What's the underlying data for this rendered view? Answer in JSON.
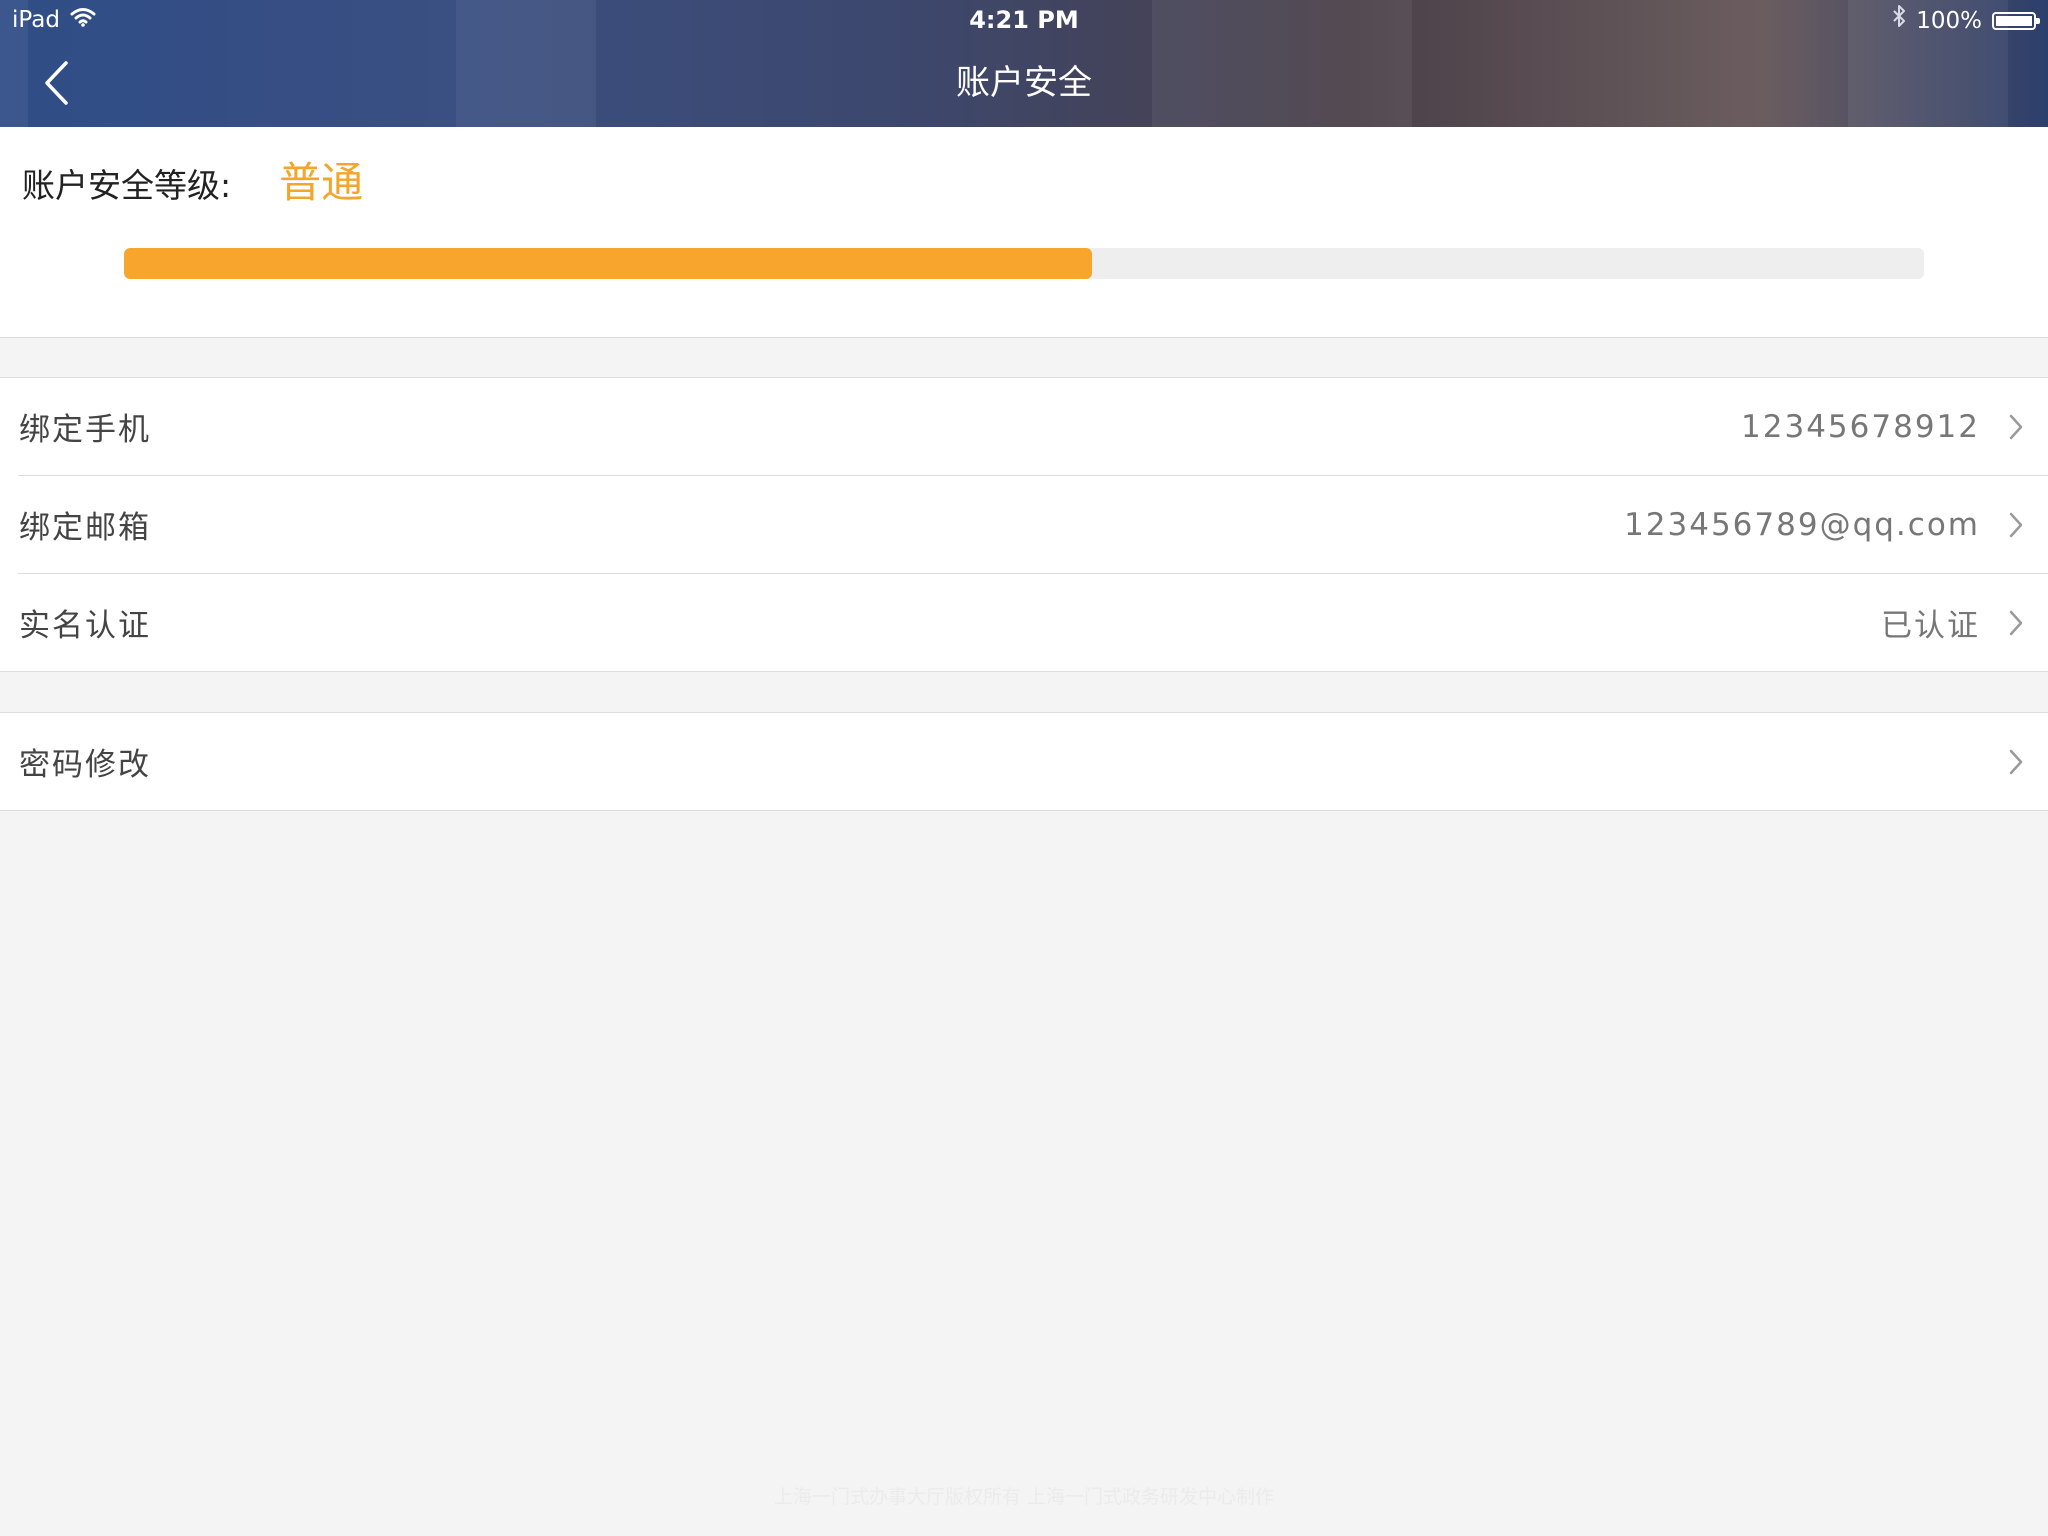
{
  "status_bar": {
    "device": "iPad",
    "time": "4:21 PM",
    "battery": "100%",
    "battery_level": 1.0
  },
  "nav": {
    "title": "账户安全",
    "back_icon": "chevron-left-icon"
  },
  "security": {
    "label": "账户安全等级:",
    "level": "普通",
    "progress": 0.538,
    "accent_color": "#f7a52d"
  },
  "groups": [
    {
      "rows": [
        {
          "label": "绑定手机",
          "value": "12345678912"
        },
        {
          "label": "绑定邮箱",
          "value": "123456789@qq.com"
        },
        {
          "label": "实名认证",
          "value": "已认证"
        }
      ]
    },
    {
      "rows": [
        {
          "label": "密码修改",
          "value": ""
        }
      ]
    }
  ],
  "footer": {
    "text": "上海一门式办事大厅版权所有 上海一门式政务研发中心制作"
  }
}
